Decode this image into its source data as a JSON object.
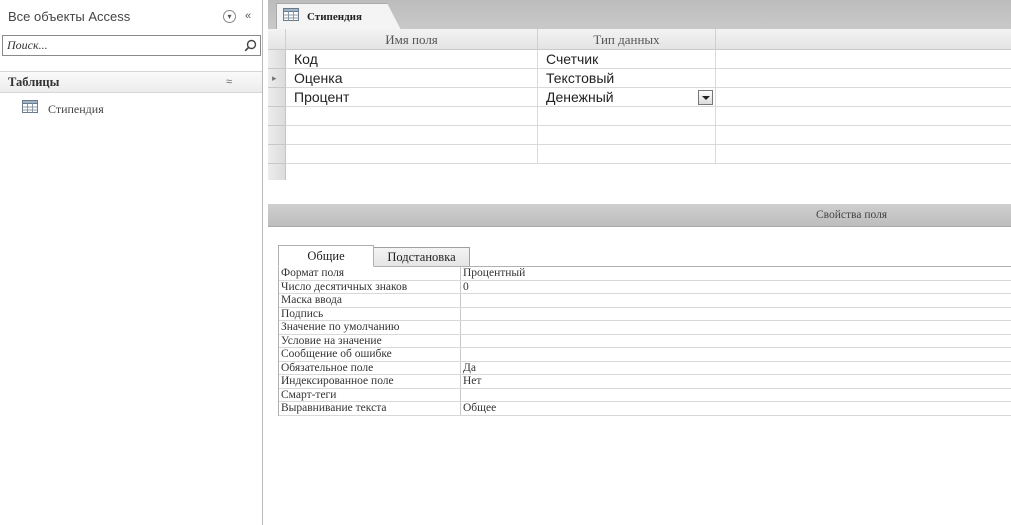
{
  "nav": {
    "title": "Все объекты Access",
    "search_placeholder": "Поиск...",
    "group_label": "Таблицы",
    "items": [
      {
        "label": "Стипендия",
        "icon": "table-icon"
      }
    ]
  },
  "tab": {
    "label": "Стипендия"
  },
  "grid": {
    "headers": {
      "field_name": "Имя поля",
      "data_type": "Тип данных"
    },
    "rows": [
      {
        "field_name": "Код",
        "data_type": "Счетчик"
      },
      {
        "field_name": "Оценка",
        "data_type": "Текстовый"
      },
      {
        "field_name": "Процент",
        "data_type": "Денежный"
      }
    ]
  },
  "properties": {
    "section_title": "Свойства поля",
    "tabs": {
      "general": "Общие",
      "lookup": "Подстановка"
    },
    "rows": [
      {
        "label": "Формат поля",
        "value": "Процентный"
      },
      {
        "label": "Число десятичных знаков",
        "value": "0"
      },
      {
        "label": "Маска ввода",
        "value": ""
      },
      {
        "label": "Подпись",
        "value": ""
      },
      {
        "label": "Значение по умолчанию",
        "value": ""
      },
      {
        "label": "Условие на значение",
        "value": ""
      },
      {
        "label": "Сообщение об ошибке",
        "value": ""
      },
      {
        "label": "Обязательное поле",
        "value": "Да"
      },
      {
        "label": "Индексированное поле",
        "value": "Нет"
      },
      {
        "label": "Смарт-теги",
        "value": ""
      },
      {
        "label": "Выравнивание текста",
        "value": "Общее"
      }
    ]
  }
}
